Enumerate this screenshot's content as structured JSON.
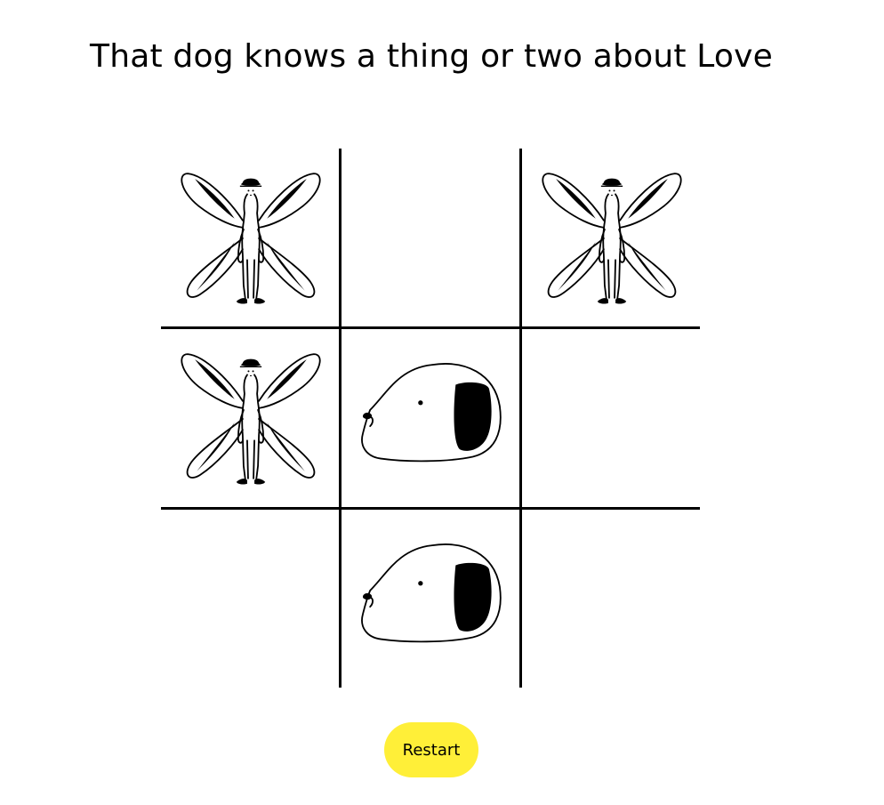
{
  "title": "That dog knows a thing or two about Love",
  "board": {
    "cells": [
      "x",
      "",
      "x",
      "x",
      "o",
      "",
      "",
      "o",
      ""
    ],
    "icons": {
      "x": "butterfly-man-icon",
      "o": "dog-head-icon"
    }
  },
  "restart": {
    "label": "Restart",
    "color": "#ffef38"
  }
}
